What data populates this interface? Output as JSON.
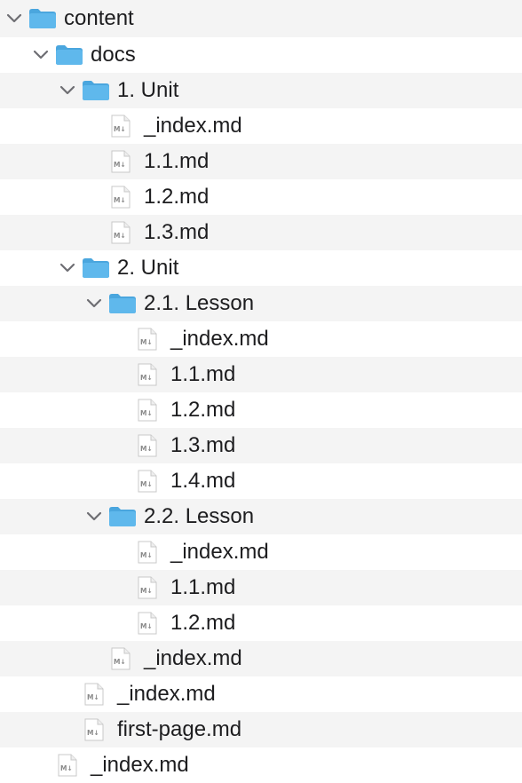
{
  "tree": {
    "content": {
      "label": "content",
      "icon": "folder-icon",
      "expanded": true
    },
    "docs": {
      "label": "docs",
      "icon": "folder-icon",
      "expanded": true
    },
    "unit1": {
      "label": "1. Unit",
      "icon": "folder-icon",
      "expanded": true
    },
    "unit1_index": {
      "label": "_index.md",
      "icon": "markdown-file-icon"
    },
    "unit1_f11": {
      "label": "1.1.md",
      "icon": "markdown-file-icon"
    },
    "unit1_f12": {
      "label": "1.2.md",
      "icon": "markdown-file-icon"
    },
    "unit1_f13": {
      "label": "1.3.md",
      "icon": "markdown-file-icon"
    },
    "unit2": {
      "label": "2. Unit",
      "icon": "folder-icon",
      "expanded": true
    },
    "lesson21": {
      "label": "2.1. Lesson",
      "icon": "folder-icon",
      "expanded": true
    },
    "l21_index": {
      "label": "_index.md",
      "icon": "markdown-file-icon"
    },
    "l21_f11": {
      "label": "1.1.md",
      "icon": "markdown-file-icon"
    },
    "l21_f12": {
      "label": "1.2.md",
      "icon": "markdown-file-icon"
    },
    "l21_f13": {
      "label": "1.3.md",
      "icon": "markdown-file-icon"
    },
    "l21_f14": {
      "label": "1.4.md",
      "icon": "markdown-file-icon"
    },
    "lesson22": {
      "label": "2.2. Lesson",
      "icon": "folder-icon",
      "expanded": true
    },
    "l22_index": {
      "label": "_index.md",
      "icon": "markdown-file-icon"
    },
    "l22_f11": {
      "label": "1.1.md",
      "icon": "markdown-file-icon"
    },
    "l22_f12": {
      "label": "1.2.md",
      "icon": "markdown-file-icon"
    },
    "unit2_index": {
      "label": "_index.md",
      "icon": "markdown-file-icon"
    },
    "docs_index": {
      "label": "_index.md",
      "icon": "markdown-file-icon"
    },
    "docs_first_page": {
      "label": "first-page.md",
      "icon": "markdown-file-icon"
    },
    "content_index": {
      "label": "_index.md",
      "icon": "markdown-file-icon"
    }
  },
  "colors": {
    "folder": "#5fb8ec",
    "folder_tab": "#4aa6de",
    "row_alt": "#f4f4f4",
    "text": "#1d1d1f",
    "chevron": "#6e6e73"
  }
}
